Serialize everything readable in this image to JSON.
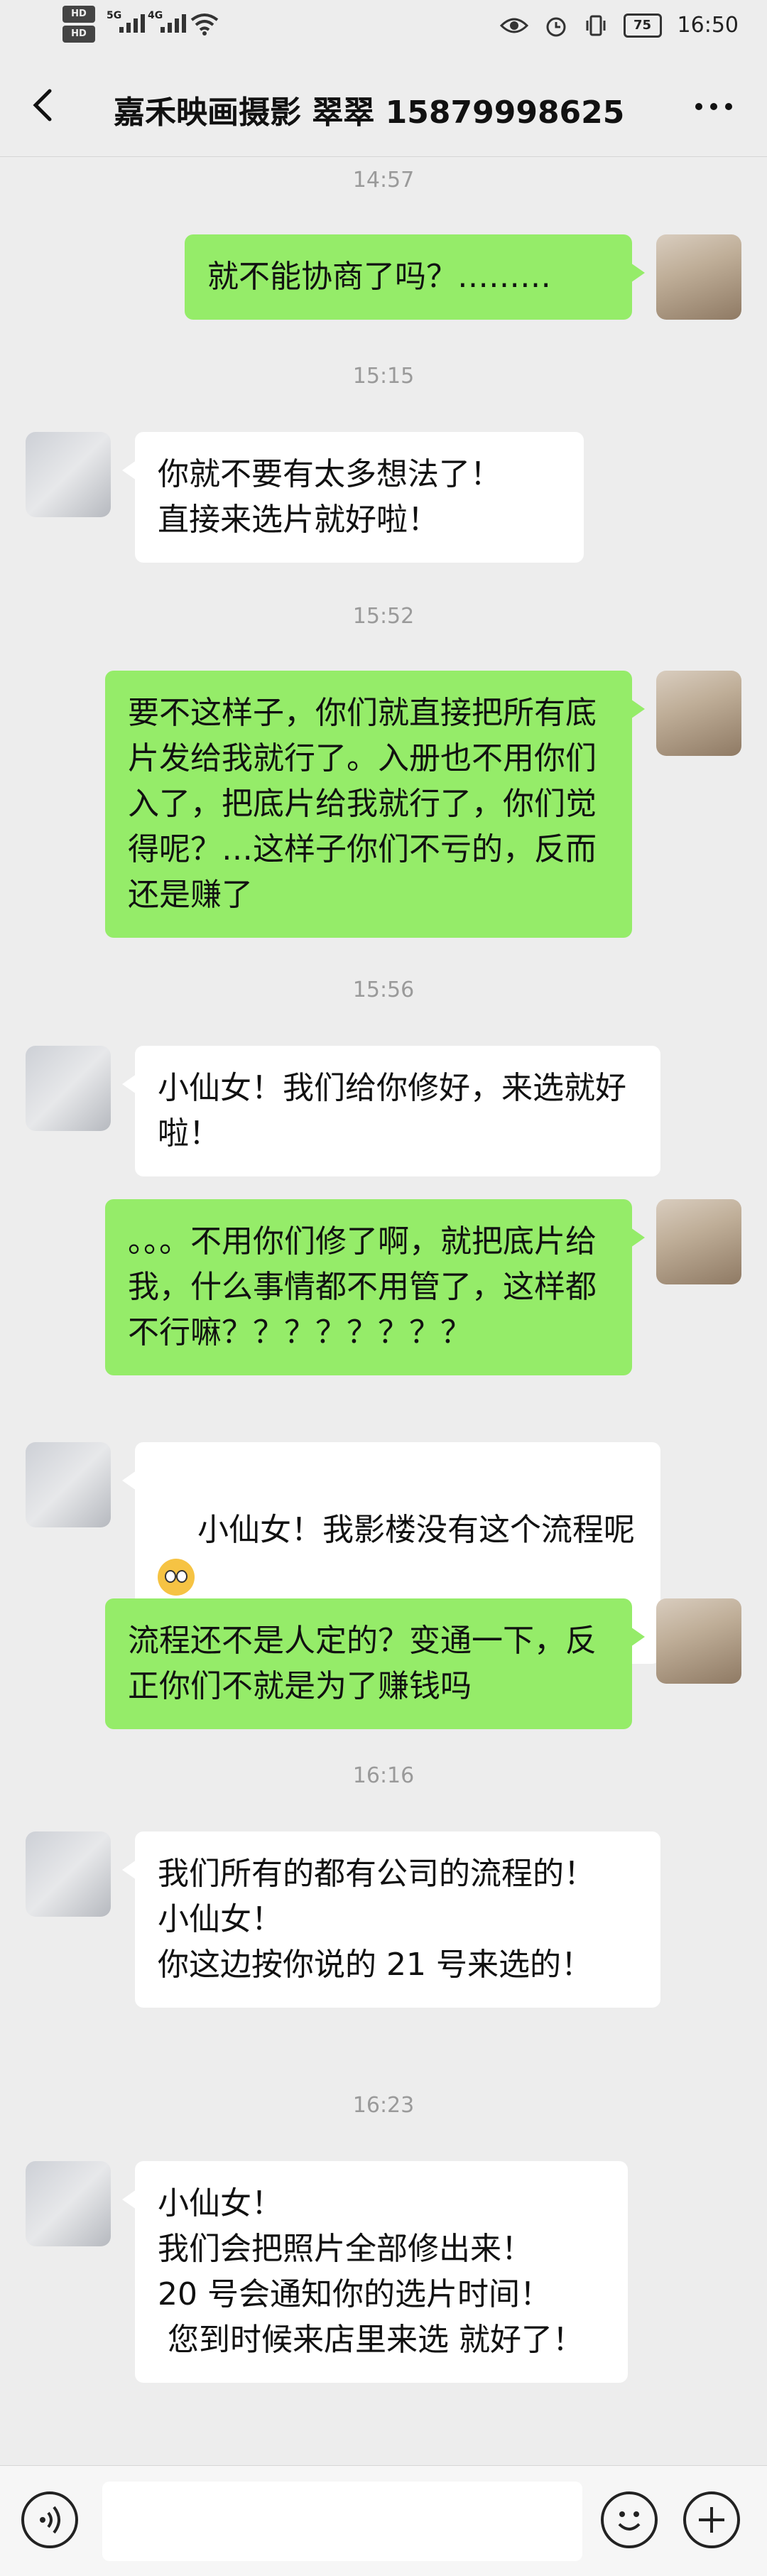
{
  "status_bar": {
    "left_indicators": [
      "HD",
      "HD"
    ],
    "network_1": "5G",
    "network_2": "4G",
    "battery": "75",
    "time": "16:50",
    "icons": [
      "eye-icon",
      "alarm-icon",
      "vibrate-icon",
      "battery-icon",
      "wifi-icon",
      "signal-icon"
    ]
  },
  "nav": {
    "title": "嘉禾映画摄影 翠翠 15879998625",
    "icons": [
      "back-icon",
      "more-icon"
    ]
  },
  "messages": [
    {
      "type": "time",
      "text": "14:57"
    },
    {
      "type": "me",
      "text": "就不能协商了吗？………"
    },
    {
      "type": "time",
      "text": "15:15"
    },
    {
      "type": "other",
      "text": "你就不要有太多想法了！\n直接来选片就好啦！"
    },
    {
      "type": "time",
      "text": "15:52"
    },
    {
      "type": "me",
      "text": "要不这样子，你们就直接把所有底片发给我就行了。入册也不用你们入了，把底片给我就行了，你们觉得呢？…这样子你们不亏的，反而还是赚了"
    },
    {
      "type": "time",
      "text": "15:56"
    },
    {
      "type": "other",
      "text": "小仙女！我们给你修好，来选就好啦！"
    },
    {
      "type": "me",
      "text": "。。。不用你们修了啊，就把底片给我，什么事情都不用管了，这样都不行嘛？？？？？？？？"
    },
    {
      "type": "other",
      "text": "小仙女！我影楼没有这个流程呢",
      "emoji": "worried-emoji-icon"
    },
    {
      "type": "me",
      "text": "流程还不是人定的？变通一下，反正你们不就是为了赚钱吗"
    },
    {
      "type": "time",
      "text": "16:16"
    },
    {
      "type": "other",
      "text": "我们所有的都有公司的流程的！\n小仙女！\n你这边按你说的 21 号来选的！"
    },
    {
      "type": "time",
      "text": "16:23"
    },
    {
      "type": "other",
      "text": "小仙女！\n我们会把照片全部修出来！\n20 号会通知你的选片时间！\n 您到时候来店里来选 就好了！"
    }
  ],
  "input_bar": {
    "placeholder": "",
    "icons": [
      "voice-icon",
      "emoji-icon",
      "plus-icon"
    ]
  },
  "colors": {
    "background": "#ededed",
    "me_bubble": "#95ec69",
    "other_bubble": "#ffffff",
    "time_text": "#9a9a9a"
  }
}
